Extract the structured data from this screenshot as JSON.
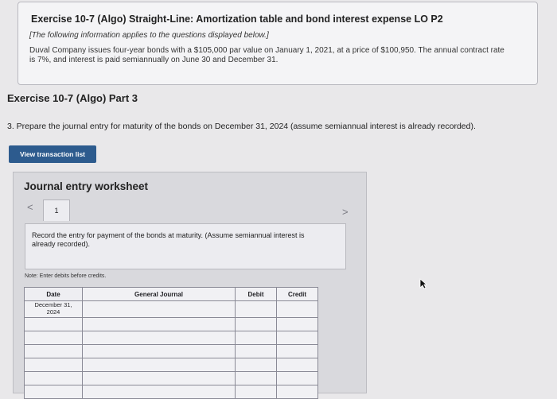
{
  "info": {
    "title": "Exercise 10-7 (Algo) Straight-Line: Amortization table and bond interest expense LO P2",
    "note": "[The following information applies to the questions displayed below.]",
    "body": "Duval Company issues four-year bonds with a $105,000 par value on January 1, 2021, at a price of $100,950. The annual contract rate is 7%, and interest is paid semiannually on June 30 and December 31."
  },
  "part_title": "Exercise 10-7 (Algo) Part 3",
  "question": "3. Prepare the journal entry for maturity of the bonds on December 31, 2024 (assume semiannual interest is already recorded).",
  "view_button_label": "View transaction list",
  "worksheet": {
    "title": "Journal entry worksheet",
    "prev_icon": "<",
    "next_icon": ">",
    "tab_label": "1",
    "instruction": "Record the entry for payment of the bonds at maturity. (Assume semiannual interest is already recorded).",
    "note": "Note: Enter debits before credits.",
    "table": {
      "headers": {
        "date": "Date",
        "general_journal": "General Journal",
        "debit": "Debit",
        "credit": "Credit"
      },
      "first_date": "December 31,\n2024"
    }
  }
}
